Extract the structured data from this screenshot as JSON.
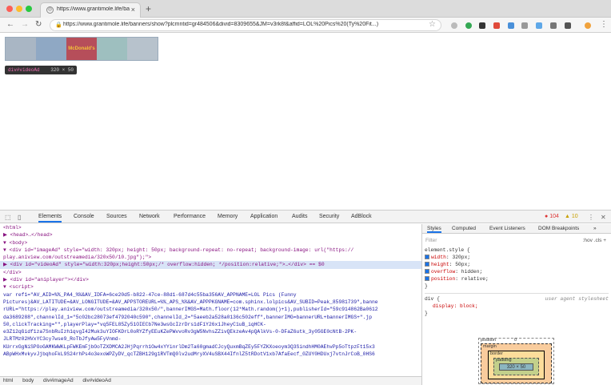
{
  "browser": {
    "tab_title": "https://www.grantimole.life/ba",
    "tab_favicon": "globe-icon",
    "url": "https://www.grantimole.life/banners/show?plcmntid=gr484506&divid=8309655&JM=v3rk8f&affid=LOL%20Pics%20(Ty%20Fit...)"
  },
  "page": {
    "banner_brand": "McDonald's",
    "tooltip_name": "div#videoAd",
    "tooltip_size": "320 × 50"
  },
  "devtools": {
    "tabs": [
      "Elements",
      "Console",
      "Sources",
      "Network",
      "Performance",
      "Memory",
      "Application",
      "Audits",
      "Security",
      "AdBlock"
    ],
    "active_tab": "Elements",
    "error_count": "104",
    "warning_count": "10",
    "dom_lines": [
      "<html>",
      "▶ <head>…</head>",
      "▼ <body>",
      "  ▼ <div id=\"imageAd\" style=\"width: 320px; height: 50px; background-repeat: no-repeat; background-image: url(\"https://",
      "    play.aniview.com/outstreamedia/320x50/10.jpg\");\">",
      "    ▶ <div id=\"videoAd\" style=\"width:320px;height:50px;/* overflow:hidden; */position:relative;\">…</div> == $0",
      "    </div>",
      "  ▶ <div id=\"aniplayer\"></div>",
      "  ▼ <script>",
      "    var ref1=\"AV_AID=%%_PA4_%%&AV_IDFA=6ce20d5-b822-47ce-88d1-687d4c55ba356AV_APPNAME=LOL Pics (Funny",
      "    Pictures)&AV_LATITUDE=&AV_LONGITUDE=&AV_APPSTOREURL=%%_APS_%%&AV_APPPKGNAME=com.sphinx.lolpics&AV_SUBID=Peak_85981739\",banne",
      "    rURL=\"https://play.aniview.com/outstreamedia/320x50/\",bannerIMGS=Math.floor(12*Math.random()+1),publisherId=\"59c914862Ba0612",
      "    da3689288\",channelId_1=\"5c02bc28073ef4792040c590\",channelId_2=\"5aeeb2a528a0136c502eff\",bannerIMG=bannerURL+bannerIMGS+\".jp",
      "    50,clickTracking=\"\",playerPlay=\"vq5FEL85Zy51OIECb7Ne3wsGcIzrDrs1dF1Y26x1JheyC1uB_iqHCK-",
      "    e3Z12qGidf1za7SnbRuIzh1qvgI42Muk3uYIOFKDrL0oRYZfyEEuKZePWvvoRv3gW5NvhsZZivQEkzeAv4pQAlkVs-0-DFaZ6utk_3y05GE0cNtB-2PK-",
      "    JLRTMz02HVxYC3cy7wse9_RoTbJfyAw5FyVnmd-",
      "    KUrrxGgNiSPOoGAMKWWKLpFWKEmFjbOoTZXDMCA2JHjPqrrh1Ow4xYYinrlDm2Ta60gmadCJcyQuxmBqZEy5FYZKXoeoym3Q3SindhHM0AEhvPp5oTtpzFt15x3",
      "    ABpWHxMvkyvJjbqhoFkL9S24rhPs4o3exoWPZyDV_qcTZBH129g1RVTmQ0lv2udMryXV4uSBX44IfnlZ5tRDotV1xb7AfaEecf_0ZUY0HDUxj7vtnJrCoB_0HS6"
    ],
    "selected_line": 5,
    "breadcrumbs": [
      "html",
      "body",
      "div#imageAd",
      "div#videoAd"
    ],
    "sidebar_tabs": [
      "Styles",
      "Computed",
      "Event Listeners",
      "DOM Breakpoints"
    ],
    "filter_placeholder": "Filter",
    "hov_cls": ":hov  .cls  +",
    "styles": {
      "element_style_header": "element.style {",
      "props": [
        {
          "name": "width",
          "value": "320px;"
        },
        {
          "name": "height",
          "value": "50px;"
        },
        {
          "name": "overflow",
          "value": "hidden;"
        },
        {
          "name": "position",
          "value": "relative;"
        }
      ],
      "close": "}",
      "ua_selector": "div {",
      "ua_label": "user agent stylesheet",
      "ua_prop": "display: block;",
      "ua_close": "}"
    },
    "box_model": {
      "position_label": "position",
      "position_value": "0",
      "margin_label": "margin",
      "border_label": "border",
      "padding_label": "padding",
      "content_size": "320 × 50"
    }
  }
}
